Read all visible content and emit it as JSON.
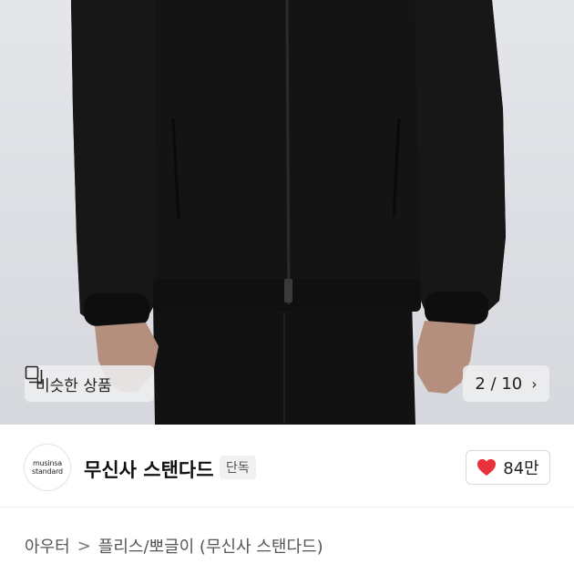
{
  "product_image": {
    "alt": ""
  },
  "similar_button": {
    "label": "비슷한 상품",
    "icon": "similar-items-icon"
  },
  "image_counter": {
    "current": "2",
    "total": "10",
    "label": "2 / 10",
    "icon": "chevron-right-icon"
  },
  "brand": {
    "logo_line1": "musinsa",
    "logo_line2": "standard",
    "name": "무신사 스탠다드",
    "badge": "단독"
  },
  "like": {
    "count": "84만",
    "icon": "heart-icon",
    "color": "#e8323c"
  },
  "breadcrumb": {
    "items": [
      "아우터",
      "플리스/뽀글이 (무신사 스탠다드)"
    ],
    "separator": ">"
  },
  "colors": {
    "garment": "#141414",
    "background": "#dfe1e5",
    "accent": "#e8323c"
  }
}
